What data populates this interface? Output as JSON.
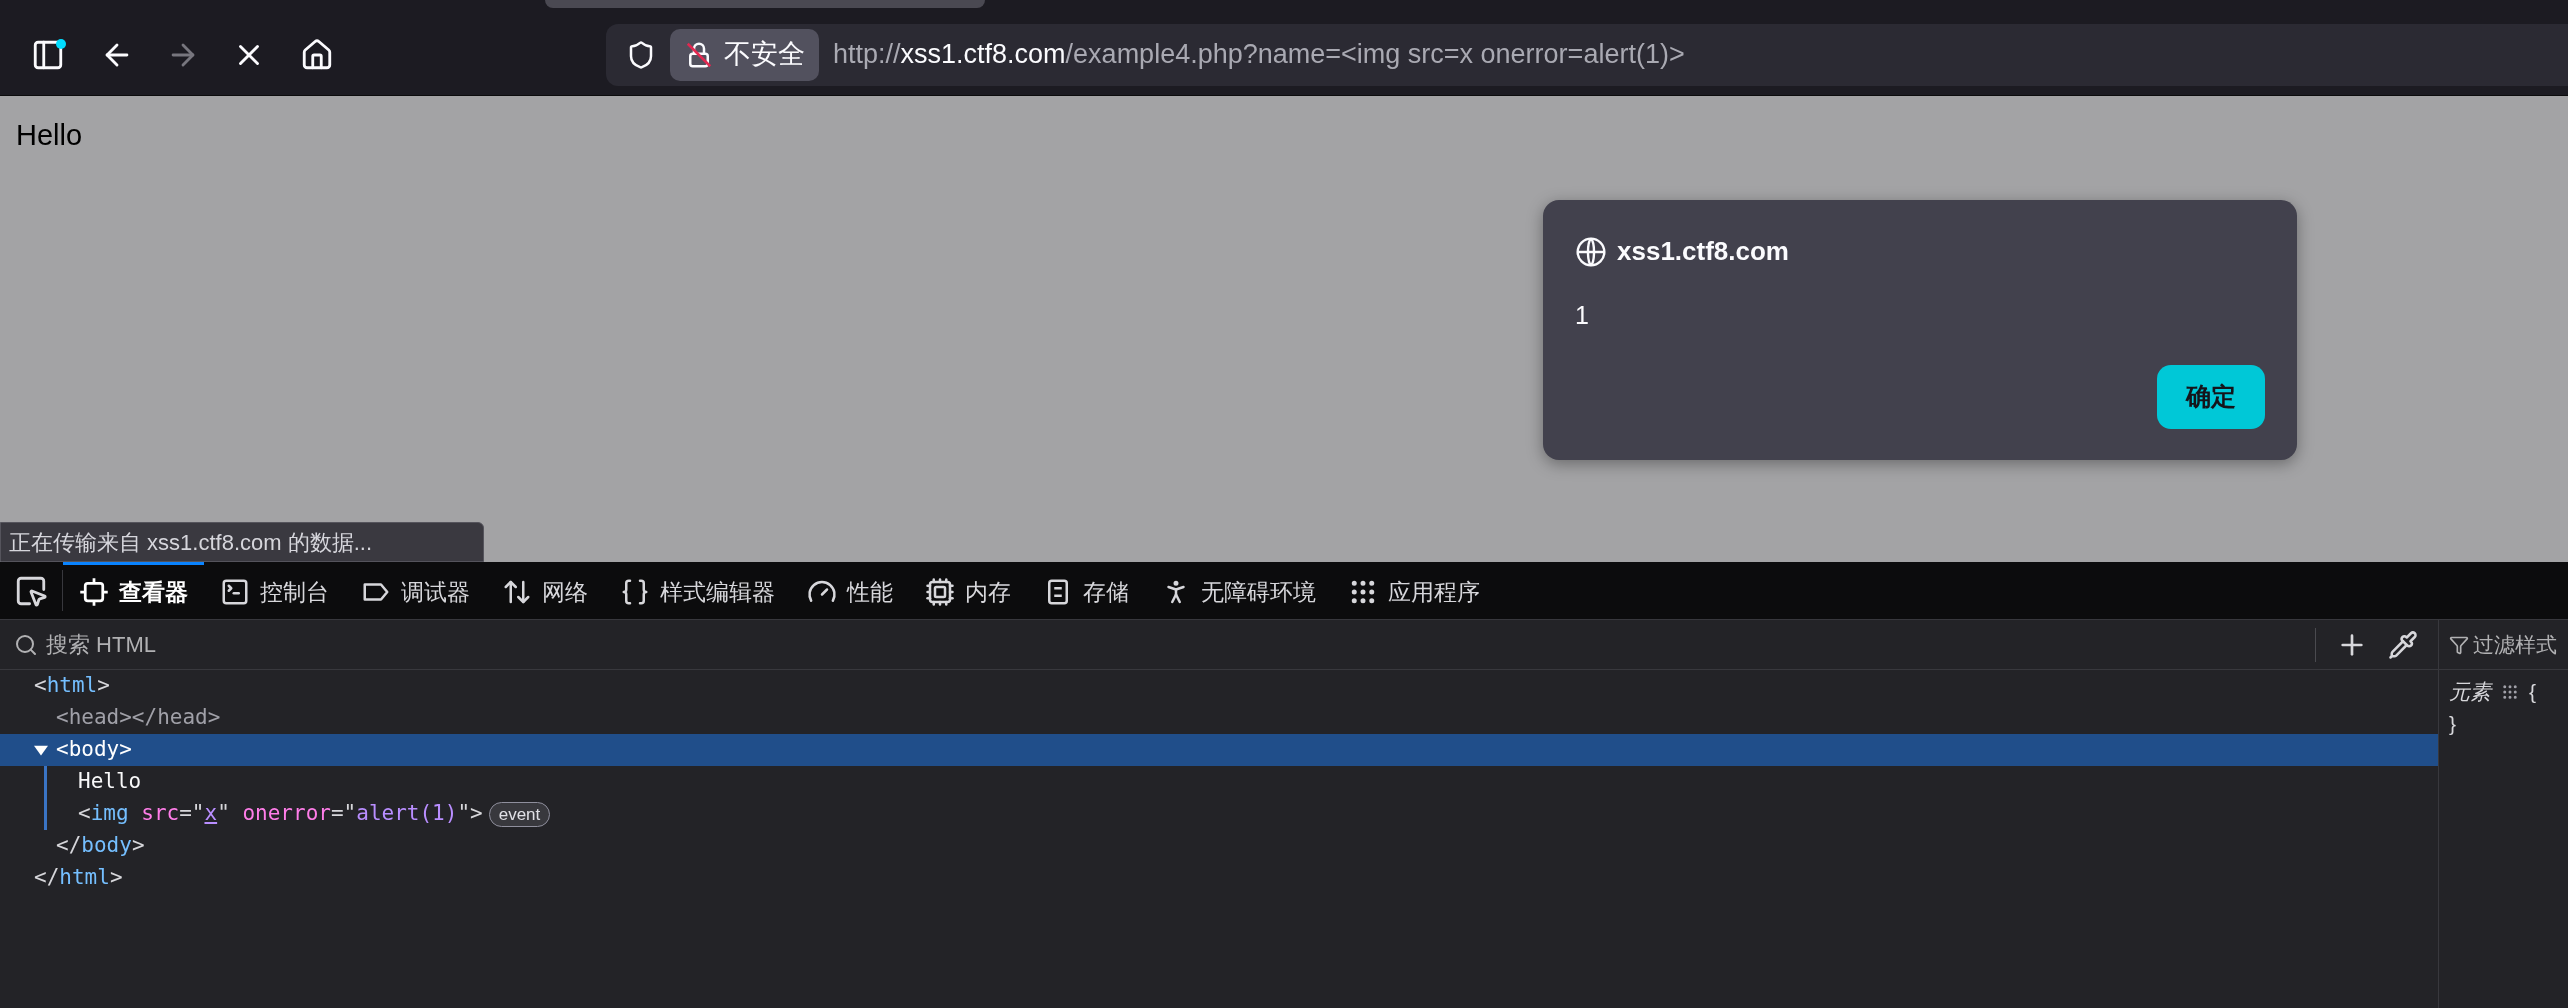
{
  "browser_toolbar": {
    "nav_buttons": [
      {
        "kind": "back",
        "disabled": false
      },
      {
        "kind": "forward",
        "disabled": true
      }
    ],
    "address_bar": {
      "security_label": "不安全",
      "url_scheme": "http://",
      "url_domain": "xss1.ctf8.com",
      "url_path": "/example4.php?name=<img src=x onerror=alert(1)>"
    }
  },
  "page": {
    "text": "Hello"
  },
  "alert_dialog": {
    "origin": "xss1.ctf8.com",
    "message": "1",
    "button": "确定"
  },
  "status_bar": "正在传输来自 xss1.ctf8.com 的数据...",
  "devtools": {
    "tabs": [
      {
        "label": "查看器",
        "selected": true
      },
      {
        "label": "控制台",
        "selected": false
      },
      {
        "label": "调试器",
        "selected": false
      },
      {
        "label": "网络",
        "selected": false
      },
      {
        "label": "样式编辑器",
        "selected": false
      },
      {
        "label": "性能",
        "selected": false
      },
      {
        "label": "内存",
        "selected": false
      },
      {
        "label": "存储",
        "selected": false
      },
      {
        "label": "无障碍环境",
        "selected": false
      },
      {
        "label": "应用程序",
        "selected": false
      }
    ],
    "search": {
      "placeholder": "搜索 HTML"
    },
    "markup_tree": [
      {
        "selected": false,
        "line": [
          {
            "kind": "punct",
            "text": "<"
          },
          {
            "kind": "tag",
            "text": "html"
          },
          {
            "kind": "punct",
            "text": ">"
          }
        ],
        "closing": [
          {
            "kind": "punct",
            "text": "</"
          },
          {
            "kind": "tag",
            "text": "html"
          },
          {
            "kind": "punct",
            "text": ">"
          }
        ],
        "children": [
          {
            "selected": false,
            "line": [
              {
                "kind": "dim",
                "text": "<head></head>"
              }
            ]
          },
          {
            "selected": true,
            "expanded": true,
            "line": [
              {
                "kind": "punct",
                "text": "<"
              },
              {
                "kind": "tag",
                "text": "body"
              },
              {
                "kind": "punct",
                "text": ">"
              }
            ],
            "closing": [
              {
                "kind": "punct",
                "text": "</"
              },
              {
                "kind": "tag",
                "text": "body"
              },
              {
                "kind": "punct",
                "text": ">"
              }
            ],
            "children": [
              {
                "selected": false,
                "line": [
                  {
                    "kind": "text",
                    "text": "Hello"
                  }
                ]
              },
              {
                "selected": false,
                "line": [
                  {
                    "kind": "punct",
                    "text": "<"
                  },
                  {
                    "kind": "tag",
                    "text": "img"
                  },
                  {
                    "kind": "attr",
                    "text": " src"
                  },
                  {
                    "kind": "punct",
                    "text": "=\""
                  },
                  {
                    "kind": "link",
                    "text": "x"
                  },
                  {
                    "kind": "punct",
                    "text": "\""
                  },
                  {
                    "kind": "attr",
                    "text": " onerror"
                  },
                  {
                    "kind": "punct",
                    "text": "=\""
                  },
                  {
                    "kind": "value",
                    "text": "alert(1)"
                  },
                  {
                    "kind": "punct",
                    "text": "\">"
                  }
                ],
                "badge": "event"
              }
            ]
          }
        ]
      }
    ],
    "rules_panel": {
      "filter_placeholder": "过滤样式",
      "selector": "元素",
      "open_brace": "{",
      "close_brace": "}"
    }
  }
}
